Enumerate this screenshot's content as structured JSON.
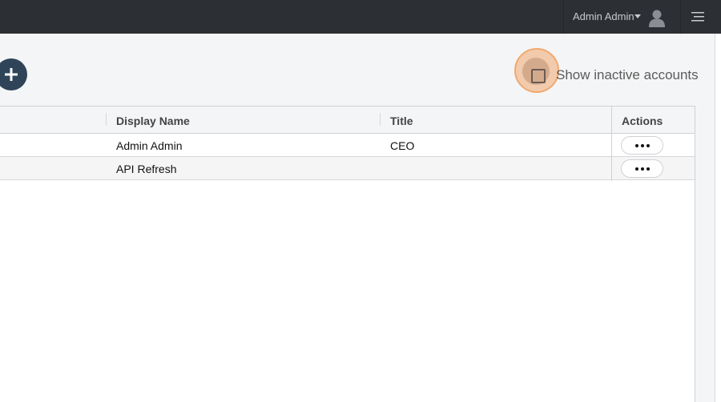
{
  "header": {
    "user_name": "Admin Admin",
    "user_icon": "user-icon",
    "menu_icon": "hamburger-menu-icon"
  },
  "toolbar": {
    "add_icon": "plus-icon",
    "show_inactive_label": "Show inactive accounts",
    "show_inactive_checked": false
  },
  "table": {
    "columns": [
      "Display Name",
      "Title",
      "Actions"
    ],
    "rows": [
      {
        "display_name": "Admin Admin",
        "title": "CEO",
        "actions_label": "•••"
      },
      {
        "display_name": "API Refresh",
        "title": "",
        "actions_label": "•••"
      }
    ]
  },
  "colors": {
    "topbar": "#2c2f33",
    "add_button": "#2f4458",
    "highlight": "#f0a970"
  }
}
